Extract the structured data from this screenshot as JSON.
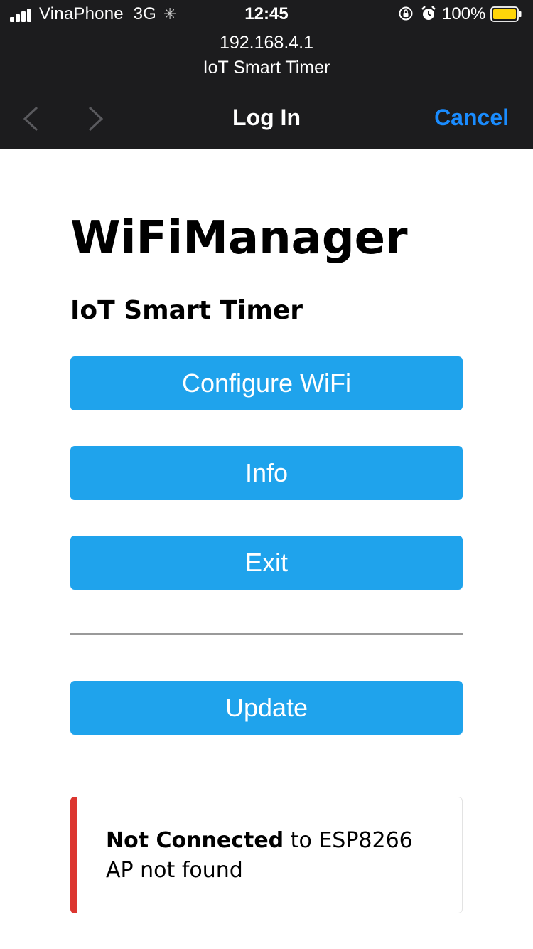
{
  "status_bar": {
    "carrier": "VinaPhone",
    "network": "3G",
    "time": "12:45",
    "battery": "100%",
    "icons": [
      "signal-icon",
      "loading-spinner-icon",
      "rotation-lock-icon",
      "alarm-icon",
      "battery-icon"
    ]
  },
  "browser": {
    "url": "192.168.4.1",
    "page_title": "IoT Smart Timer",
    "nav_title": "Log In",
    "cancel_label": "Cancel",
    "accent_color": "#1a8cff"
  },
  "page": {
    "heading": "WiFiManager",
    "subheading": "IoT Smart Timer",
    "buttons": {
      "configure": "Configure WiFi",
      "info": "Info",
      "exit": "Exit",
      "update": "Update"
    },
    "button_color": "#1fa3ec",
    "status": {
      "strong": "Not Connected",
      "rest": " to ESP8266",
      "line2": "AP not found",
      "accent_color": "#dc3630"
    }
  }
}
